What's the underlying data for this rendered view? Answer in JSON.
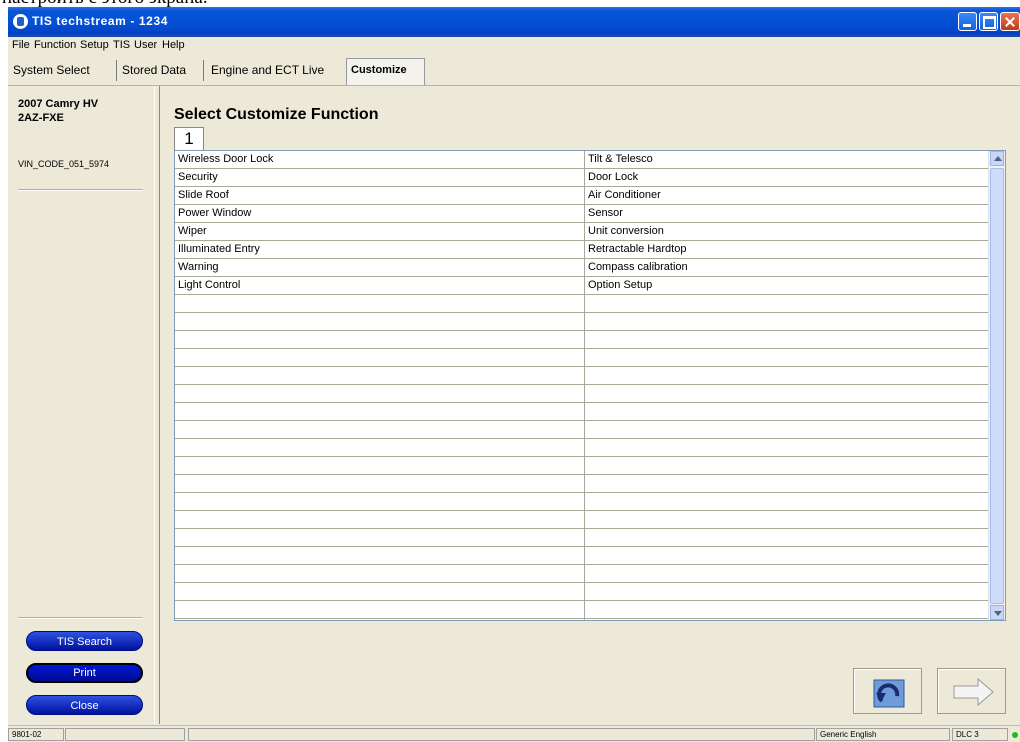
{
  "window": {
    "title": "TIS techstream - 1234"
  },
  "menu": [
    "File",
    "Function",
    "Setup",
    "TIS",
    "User",
    "Help"
  ],
  "tabs": [
    "System Select",
    "Stored Data",
    "Engine and ECT Live",
    "Customize"
  ],
  "sidebar": {
    "model_line1": "2007 Camry HV",
    "model_line2": "2AZ-FXE",
    "vin": "VIN_CODE_051_5974",
    "buttons": {
      "tis_search": "TIS Search",
      "print": "Print",
      "close": "Close"
    }
  },
  "main": {
    "title": "Select Customize Function",
    "badge": "1",
    "rows": [
      [
        "Wireless Door Lock",
        "Tilt & Telesco"
      ],
      [
        "Security",
        "Door Lock"
      ],
      [
        "Slide Roof",
        "Air Conditioner"
      ],
      [
        "Power Window",
        "Sensor"
      ],
      [
        "Wiper",
        "Unit conversion"
      ],
      [
        "Illuminated Entry",
        "Retractable Hardtop"
      ],
      [
        "Warning",
        "Compass calibration"
      ],
      [
        "Light Control",
        "Option Setup"
      ]
    ],
    "empty_rows": 18
  },
  "nav": {
    "back_icon": "undo-arrow-icon",
    "next_icon": "right-arrow-icon"
  },
  "status": {
    "left": "9801-02",
    "language": "Generic English",
    "connection": "DLC 3",
    "connection_color": "#1bbd1b"
  }
}
